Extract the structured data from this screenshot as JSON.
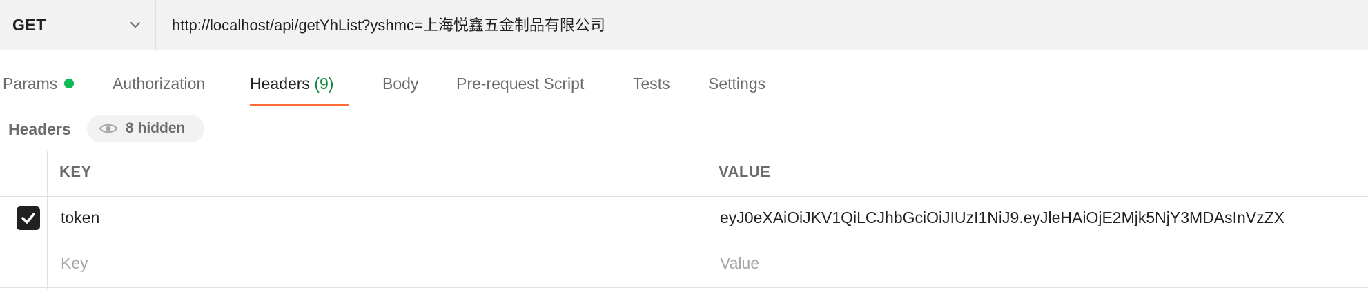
{
  "request": {
    "method": "GET",
    "url": "http://localhost/api/getYhList?yshmc=上海悦鑫五金制品有限公司"
  },
  "tabs": {
    "params": "Params",
    "authorization": "Authorization",
    "headers": "Headers",
    "headers_count": "(9)",
    "body": "Body",
    "pre_request": "Pre-request Script",
    "tests": "Tests",
    "settings": "Settings"
  },
  "headers_section": {
    "title": "Headers",
    "hidden_label": "8 hidden"
  },
  "table": {
    "columns": [
      "KEY",
      "VALUE"
    ],
    "rows": [
      {
        "checked": true,
        "key": "token",
        "value": "eyJ0eXAiOiJKV1QiLCJhbGciOiJIUzI1NiJ9.eyJleHAiOjE2Mjk5NjY3MDAsInVzZX"
      }
    ],
    "placeholder": {
      "key": "Key",
      "value": "Value"
    }
  },
  "colors": {
    "accent": "#ff6c37",
    "status_dot": "#0cbb52",
    "count_text": "#0f8a3c"
  }
}
